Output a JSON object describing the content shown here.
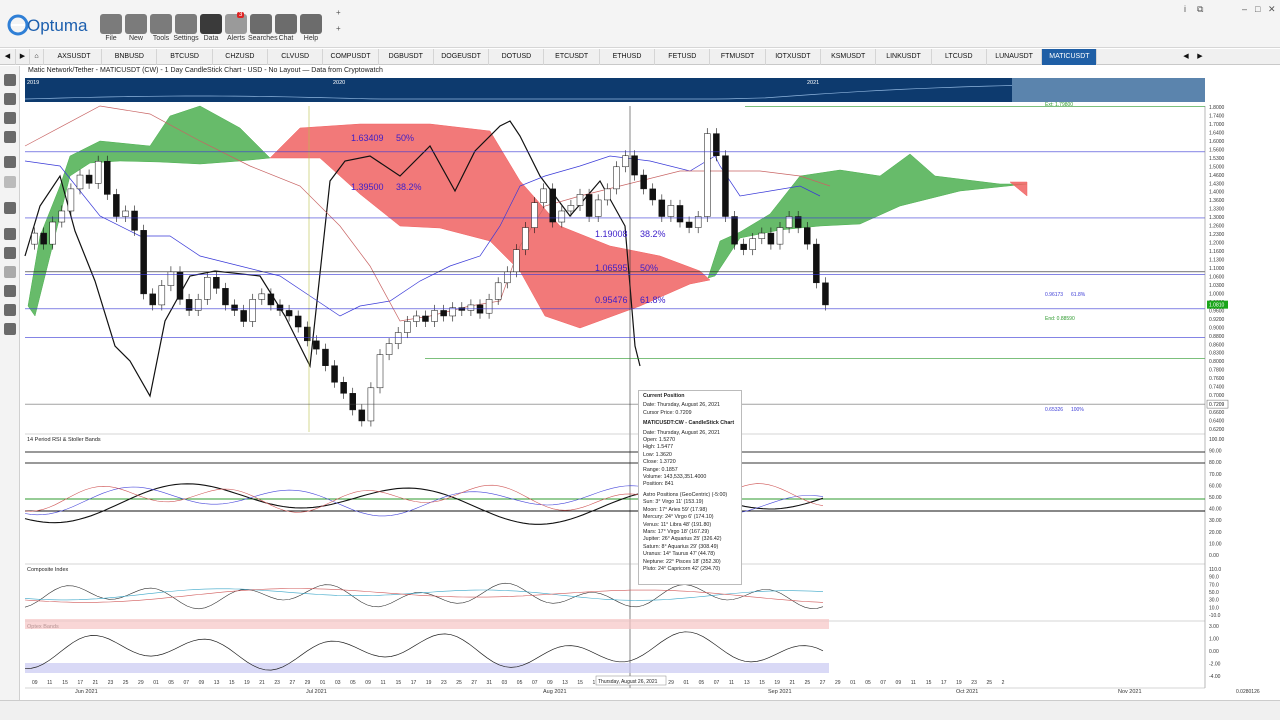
{
  "app": {
    "name": "Optuma"
  },
  "toolbar": [
    {
      "label": "File",
      "icon": "folder-icon"
    },
    {
      "label": "New",
      "icon": "folder-new-icon"
    },
    {
      "label": "Tools",
      "icon": "tools-icon"
    },
    {
      "label": "Settings",
      "icon": "gear-icon"
    },
    {
      "label": "Data",
      "icon": "data-icon"
    },
    {
      "label": "Alerts",
      "icon": "alarm-icon",
      "badge": "3"
    },
    {
      "label": "Searches",
      "icon": "search-icon"
    },
    {
      "label": "Chat",
      "icon": "chat-icon"
    },
    {
      "label": "Help",
      "icon": "help-icon"
    }
  ],
  "tabs": [
    "AXSUSDT",
    "BNBUSD",
    "BTCUSD",
    "CHZUSD",
    "CLVUSD",
    "COMPUSDT",
    "DGBUSDT",
    "DOGEUSDT",
    "DOTUSD",
    "ETCUSDT",
    "ETHUSD",
    "FETUSD",
    "FTMUSDT",
    "IOTXUSDT",
    "KSMUSDT",
    "LINKUSDT",
    "LTCUSD",
    "LUNAUSDT",
    "MATICUSDT"
  ],
  "active_tab": "MATICUSDT",
  "chart": {
    "title": "Matic Network/Tether - MATICUSDT (CW) - 1 Day CandleStick Chart - USD - No Layout — Data from Cryptowatch",
    "overview_years": [
      "2019",
      "2020",
      "2021"
    ],
    "fib_labels": [
      {
        "price": "1.63409",
        "pct": "50%"
      },
      {
        "price": "1.39500",
        "pct": "38.2%"
      },
      {
        "price": "1.19008",
        "pct": "38.2%"
      },
      {
        "price": "1.06595",
        "pct": "50%"
      },
      {
        "price": "0.95476",
        "pct": "61.8%"
      }
    ],
    "ext_labels": [
      {
        "text": "Ext: 1.79800"
      },
      {
        "text": "0.96173",
        "pct": "61.8%"
      },
      {
        "text": "End: 0.88590"
      },
      {
        "text": "0.65326",
        "pct": "100%"
      }
    ],
    "price_axis": [
      "1.8000",
      "1.7400",
      "1.7000",
      "1.6400",
      "1.6000",
      "1.5600",
      "1.5300",
      "1.5000",
      "1.4600",
      "1.4300",
      "1.4000",
      "1.3600",
      "1.3300",
      "1.3000",
      "1.2600",
      "1.2300",
      "1.2000",
      "1.1600",
      "1.1300",
      "1.1000",
      "1.0600",
      "1.0300",
      "1.0000",
      "0.9800",
      "0.9600",
      "0.9200",
      "0.9000",
      "0.8800",
      "0.8600",
      "0.8300",
      "0.8000",
      "0.7800",
      "0.7600",
      "0.7400",
      "0.7000",
      "0.6800",
      "0.6600",
      "0.6400",
      "0.6200"
    ],
    "last_price": "1.0810",
    "cursor_price": "0.7209",
    "rsi": {
      "title": "14 Period RSI & Stoller Bands",
      "axis": [
        "100.00",
        "90.00",
        "80.00",
        "70.00",
        "60.00",
        "50.00",
        "40.00",
        "30.00",
        "20.00",
        "10.00",
        "0.00"
      ]
    },
    "composite": {
      "title": "Composite Index",
      "axis": [
        "110.0",
        "90.0",
        "70.0",
        "50.0",
        "30.0",
        "10.0",
        "-10.0"
      ]
    },
    "optex": {
      "title": "Optex Bands",
      "axis": [
        "3.00",
        "1.00",
        "0.00",
        "-2.00",
        "-4.00"
      ]
    },
    "date_axis": {
      "days": [
        "09",
        "11",
        "15",
        "17",
        "21",
        "23",
        "25",
        "29",
        "01",
        "05",
        "07",
        "09",
        "13",
        "15",
        "19",
        "21",
        "23",
        "27",
        "29",
        "01",
        "03",
        "05",
        "09",
        "11",
        "15",
        "17",
        "19",
        "23",
        "25",
        "27",
        "31",
        "03",
        "05",
        "07",
        "09",
        "13",
        "15",
        "17",
        "21",
        "23",
        "25",
        "27",
        "29",
        "01",
        "05",
        "07",
        "11",
        "13",
        "15",
        "19",
        "21",
        "25",
        "27",
        "29",
        "01",
        "05",
        "07",
        "09",
        "11",
        "15",
        "17",
        "19",
        "23",
        "25",
        "2"
      ],
      "months": [
        "Jun 2021",
        "Jul 2021",
        "Aug 2021",
        "Sep 2021",
        "Oct 2021",
        "Nov 2021"
      ],
      "cursor_date": "Thursday, August 26, 2021",
      "right_value": "0.0280126"
    },
    "status_value": "14860.00"
  },
  "tooltip": {
    "title": "Current Position",
    "lines1": [
      "Date: Thursday, August 26, 2021",
      "Cursor Price: 0.7209"
    ],
    "title2": "MATICUSDT:CW - CandleStick Chart",
    "lines2": [
      "Date: Thursday, August 26, 2021",
      "Open: 1.5270",
      "High: 1.5477",
      "Low: 1.3620",
      "Close: 1.3720",
      "Range: 0.1857",
      "Volume: 143,533,351.4000",
      "Position: 841"
    ],
    "title3": "Astro Positions (GeoCentric) (-5:00)",
    "lines3": [
      "Sun: 3° Virgo 11' (153.19)",
      "Moon: 17° Aries 59' (17.98)",
      "Mercury: 24° Virgo 6' (174.10)",
      "Venus: 11° Libra 48' (191.80)",
      "Mars: 17° Virgo 18' (167.29)",
      "Jupiter: 26° Aquarius 25' (326.42)",
      "Saturn: 8° Aquarius 29' (308.49)",
      "Uranus: 14° Taurus 47' (44.78)",
      "Neptune: 22° Pisces 18' (352.30)",
      "Pluto: 24° Capricorn 42' (294.70)"
    ]
  },
  "colors": {
    "cloud_bull": "#4caf50",
    "cloud_bear": "#f06262",
    "fib_text": "#3b1ec9",
    "tab_active": "#1f5fa6",
    "overview": "#0d3a6e"
  }
}
